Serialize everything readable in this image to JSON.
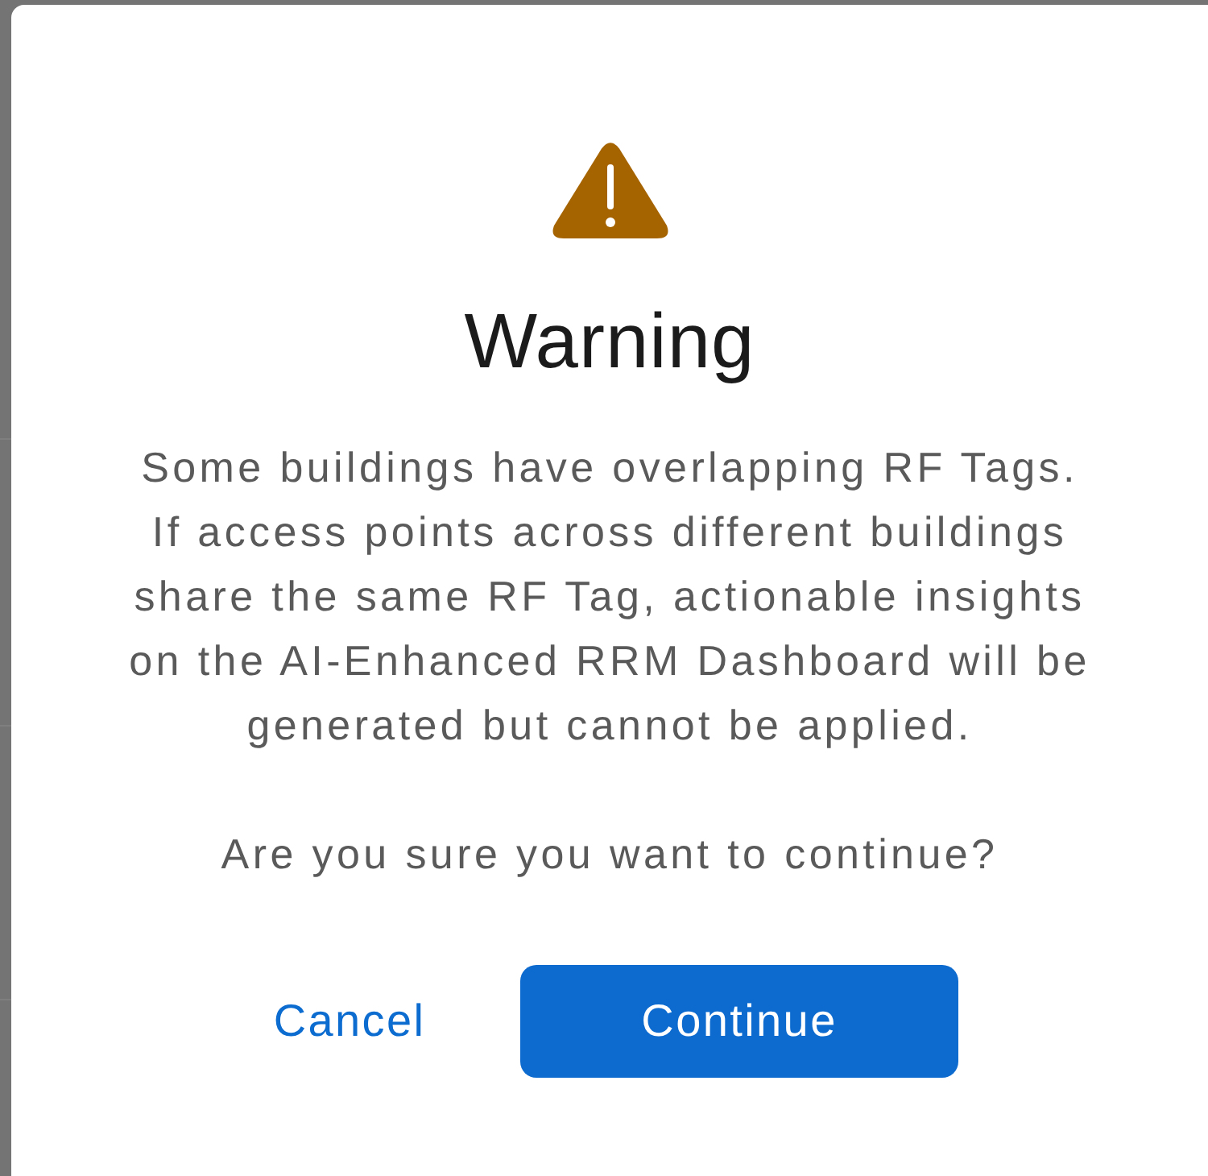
{
  "dialog": {
    "kind": "warning",
    "title": "Warning",
    "message_lines": [
      "Some buildings have overlapping RF Tags.",
      "If access points across different buildings",
      "share the same RF Tag, actionable insights",
      "on the AI-Enhanced RRM Dashboard will be",
      "generated but cannot be applied."
    ],
    "question": "Are you sure you want to continue?",
    "buttons": [
      {
        "label": "Cancel",
        "kind": "secondary"
      },
      {
        "label": "Continue",
        "kind": "primary"
      }
    ]
  }
}
